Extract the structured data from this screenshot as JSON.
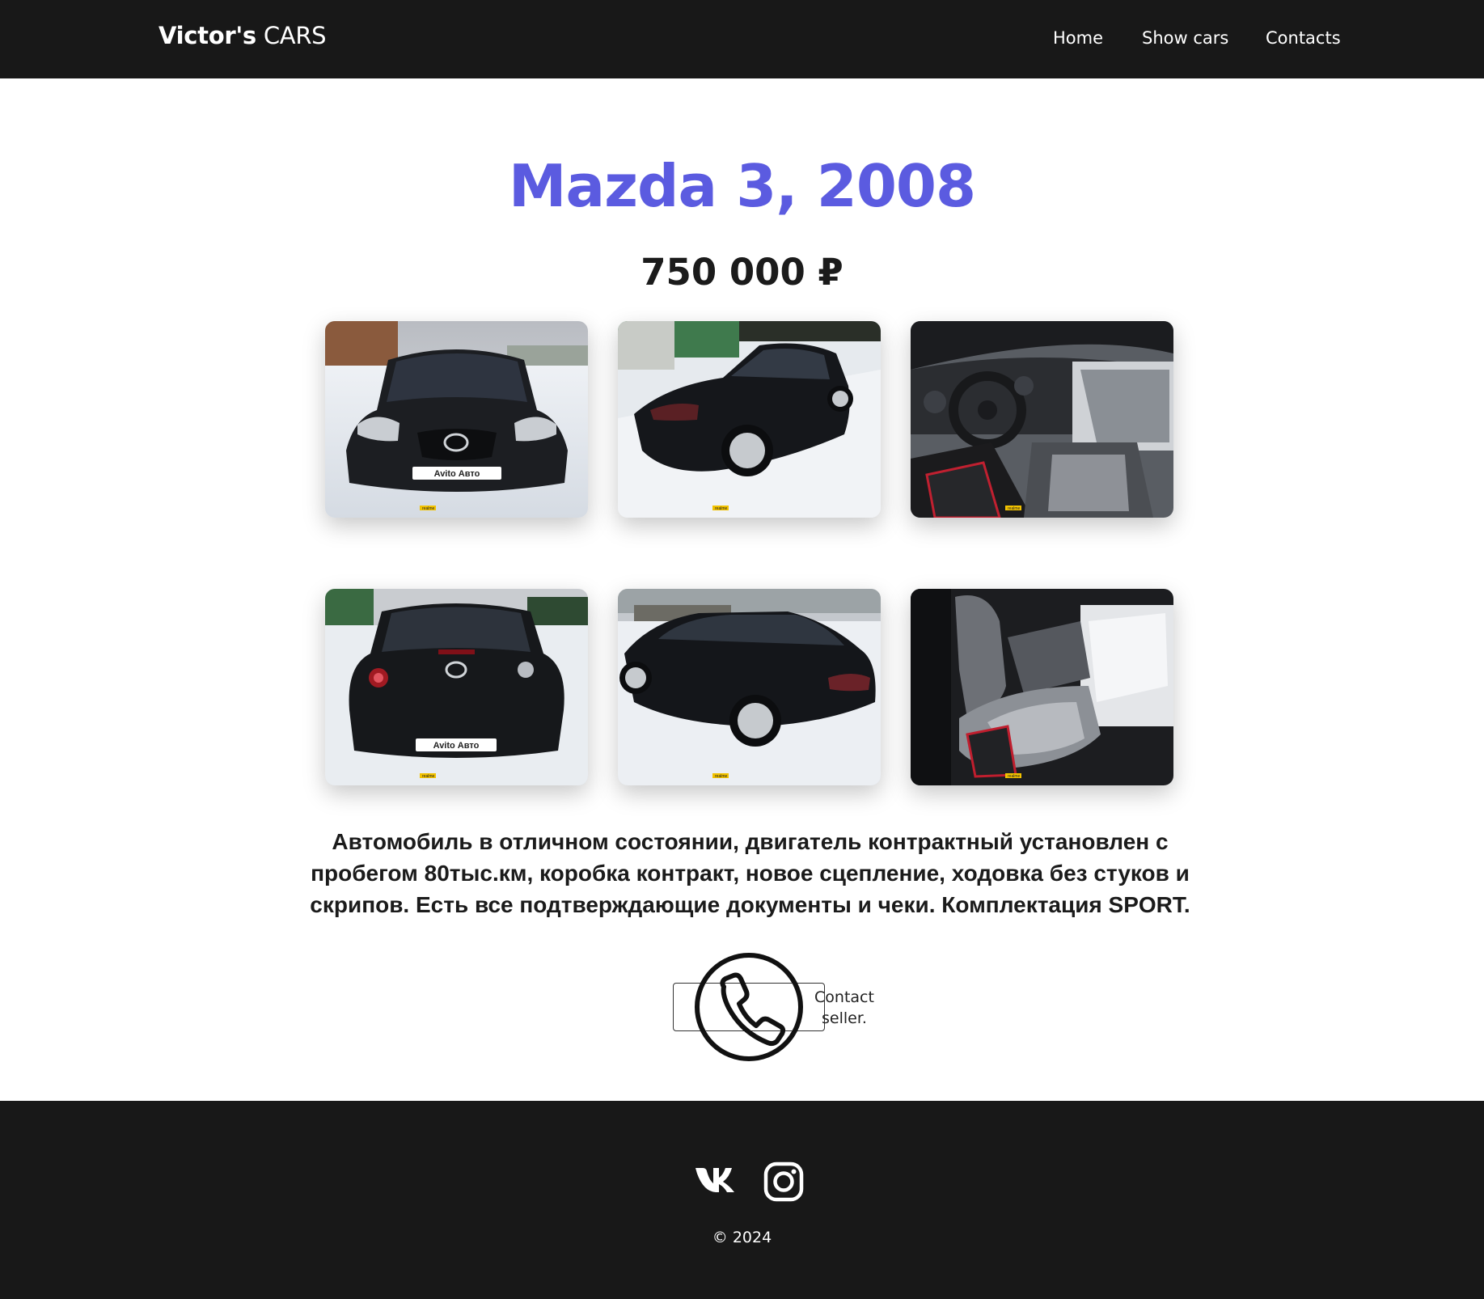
{
  "header": {
    "brand_bold": "Victor's",
    "brand_light": "CARS",
    "nav": [
      {
        "label": "Home"
      },
      {
        "label": "Show cars"
      },
      {
        "label": "Contacts"
      }
    ]
  },
  "car": {
    "title": "Mazda 3, 2008",
    "price": "750 000 ₽",
    "description": "Автомобиль в отличном состоянии, двигатель контрактный установлен с пробегом 80тыс.км, коробка контракт, новое сцепление, ходовка без стуков и скрипов. Есть все подтверждающие документы и чеки. Комплектация SPORT.",
    "photos": [
      {
        "icon": "car-front-photo",
        "plate_text": "Avito Авто",
        "watermark": "realme"
      },
      {
        "icon": "car-rear-side-photo",
        "plate_text": "",
        "watermark": "realme"
      },
      {
        "icon": "car-interior-dashboard-photo",
        "plate_text": "",
        "watermark": "realme"
      },
      {
        "icon": "car-rear-photo",
        "plate_text": "Avito Авто",
        "watermark": "realme"
      },
      {
        "icon": "car-side-rear-photo",
        "plate_text": "",
        "watermark": "realme"
      },
      {
        "icon": "car-interior-seats-photo",
        "plate_text": "",
        "watermark": "realme"
      }
    ]
  },
  "contact": {
    "label": "Contact seller.",
    "icon": "phone-icon"
  },
  "footer": {
    "social": [
      {
        "icon": "vk-icon"
      },
      {
        "icon": "instagram-icon"
      }
    ],
    "copyright": "© 2024"
  },
  "colors": {
    "accent": "#5b5be0",
    "bar": "#181818",
    "text": "#1b1b1b"
  }
}
